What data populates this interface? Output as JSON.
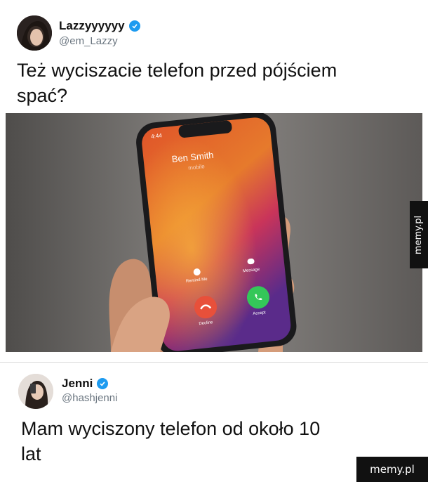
{
  "tweet1": {
    "name": "Lazzyyyyyy",
    "handle": "@em_Lazzy",
    "text_line1": "Też wyciszacie telefon przed pójściem",
    "text_line2": "spać?"
  },
  "phone_screen": {
    "time": "4:44",
    "caller": "Ben Smith",
    "caller_type": "mobile",
    "remind_me": "Remind Me",
    "message": "Message",
    "decline": "Decline",
    "accept": "Accept"
  },
  "tweet2": {
    "name": "Jenni",
    "handle": "@hashjenni",
    "text_line1": "Mam wyciszony telefon od około 10",
    "text_line2": "lat"
  },
  "watermark": {
    "side": "memy.pl",
    "corner": "memy.pl"
  },
  "colors": {
    "verified": "#1d9bf0",
    "decline": "#e8503a",
    "accept": "#34c759"
  },
  "icons": [
    "verified-badge-icon",
    "alarm-icon",
    "message-bubble-icon",
    "phone-decline-icon",
    "phone-accept-icon"
  ]
}
